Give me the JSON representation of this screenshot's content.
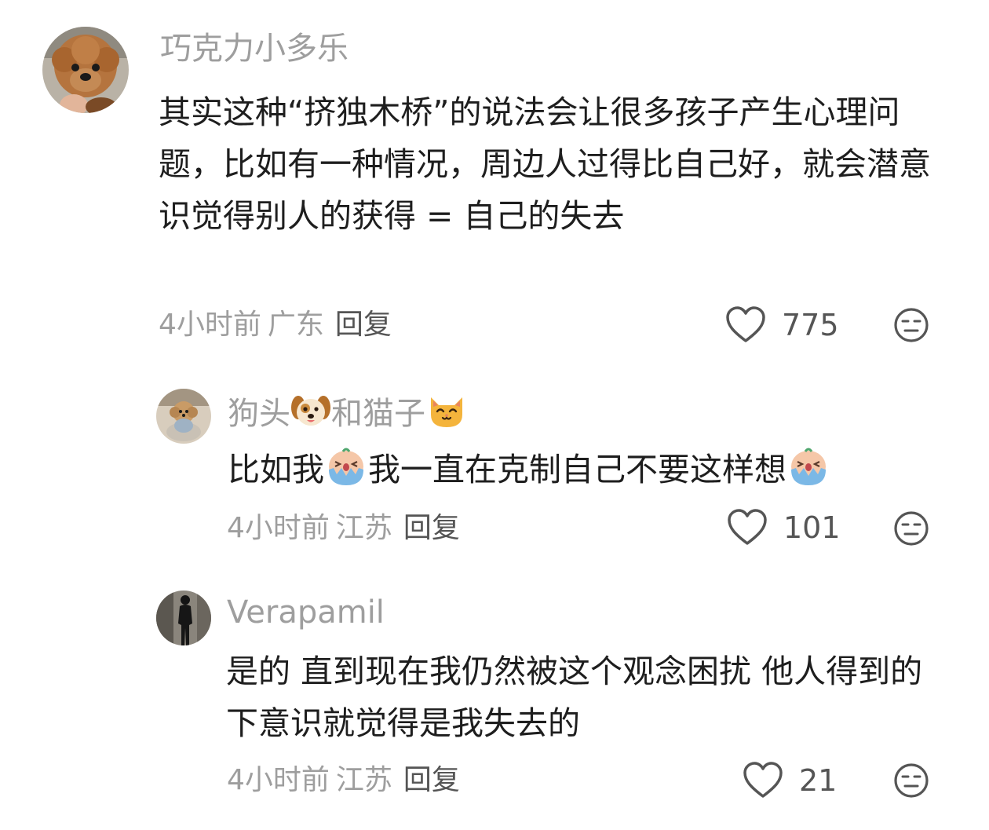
{
  "comments": [
    {
      "username": "巧克力小多乐",
      "text": "其实这种“挤独木桥”的说法会让很多孩子产生心理问题，比如有一种情况，周边人过得比自己好，就会潜意识觉得别人的获得 = 自己的失去",
      "time": "4小时前",
      "location": "广东",
      "reply_label": "回复",
      "likes": "775",
      "avatar_icon": "poodle-avatar"
    },
    {
      "username_parts": [
        "狗头",
        "和猫子"
      ],
      "username_icons": [
        "dog-face-icon",
        "cat-face-icon"
      ],
      "text_parts": [
        "比如我",
        "我一直在克制自己不要这样想"
      ],
      "text_icons": [
        "crying-emoji-icon",
        "crying-emoji-icon"
      ],
      "time": "4小时前",
      "location": "江苏",
      "reply_label": "回复",
      "likes": "101",
      "avatar_icon": "small-dog-avatar"
    },
    {
      "username": "Verapamil",
      "text": "是的 直到现在我仍然被这个观念困扰 他人得到的 下意识就觉得是我失去的",
      "time": "4小时前",
      "location": "江苏",
      "reply_label": "回复",
      "likes": "21",
      "avatar_icon": "person-silhouette-avatar"
    }
  ],
  "icons": {
    "like": "heart-outline-icon",
    "dislike": "unamused-face-icon"
  },
  "colors": {
    "background": "#ffffff",
    "text": "#1e1e1e",
    "muted": "#9e9e9e",
    "action": "#555555"
  }
}
